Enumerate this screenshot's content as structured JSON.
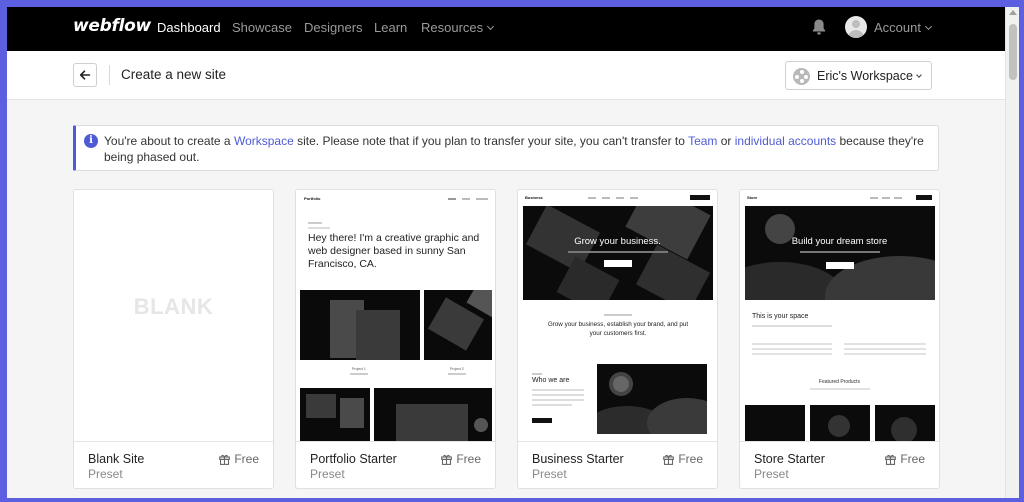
{
  "nav": {
    "logo": "webflow",
    "items": [
      {
        "label": "Dashboard",
        "active": true
      },
      {
        "label": "Showcase"
      },
      {
        "label": "Designers"
      },
      {
        "label": "Learn"
      },
      {
        "label": "Resources"
      }
    ],
    "account_label": "Account"
  },
  "header": {
    "title": "Create a new site",
    "workspace_label": "Eric's Workspace"
  },
  "notice": {
    "part1": "You're about to create a ",
    "link1": "Workspace",
    "part2": " site. Please note that if you plan to transfer your site, you can't transfer to ",
    "link2": "Team",
    "part3": " or ",
    "link3": "individual accounts",
    "part4": " because they're being phased out."
  },
  "templates": [
    {
      "name": "Blank Site",
      "sub": "Preset",
      "price": "Free",
      "thumb_word": "BLANK"
    },
    {
      "name": "Portfolio Starter",
      "sub": "Preset",
      "price": "Free",
      "preview": {
        "logo": "Portfolio",
        "heading": "Hey there! I'm a creative graphic and web designer based in sunny San Francisco, CA.",
        "project1": "Project 1",
        "project2": "Project 2"
      }
    },
    {
      "name": "Business Starter",
      "sub": "Preset",
      "price": "Free",
      "preview": {
        "logo": "Business",
        "hero": "Grow your business.",
        "tagline": "Grow your business, establish your brand, and put your customers first.",
        "who": "Who we are"
      }
    },
    {
      "name": "Store Starter",
      "sub": "Preset",
      "price": "Free",
      "preview": {
        "logo": "Store",
        "hero": "Build your dream store",
        "space": "This is your space",
        "featured": "Featured Products"
      }
    }
  ],
  "colors": {
    "accent": "#4f5bd5",
    "nav_bg": "#000000",
    "frame": "#5b5fe0"
  }
}
